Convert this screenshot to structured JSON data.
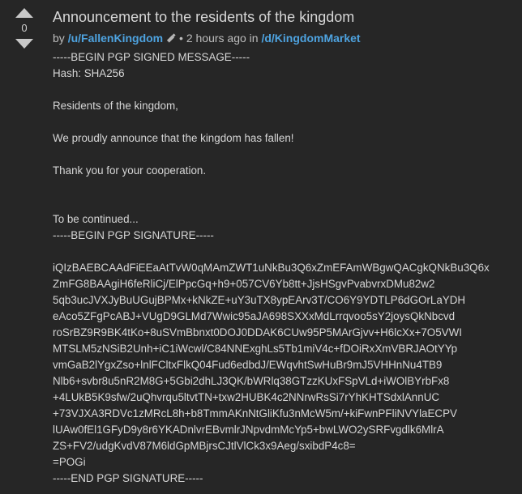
{
  "vote": {
    "score": "0",
    "upvote_icon": "upvote-arrow-icon",
    "downvote_icon": "downvote-arrow-icon"
  },
  "post": {
    "title": "Announcement to the residents of the kingdom",
    "meta": {
      "prefix": "by",
      "author": "/u/FallenKingdom",
      "badge_icon": "pgp-key-icon",
      "separator": "•",
      "time": "2 hours ago",
      "in_label": "in",
      "community": "/d/KingdomMarket"
    },
    "body_lines": [
      "-----BEGIN PGP SIGNED MESSAGE-----",
      "Hash: SHA256",
      "",
      "Residents of the kingdom,",
      "",
      "We proudly announce that the kingdom has fallen!",
      "",
      "Thank you for your cooperation.",
      "",
      "",
      "To be continued...",
      "-----BEGIN PGP SIGNATURE-----",
      "",
      "iQIzBAEBCAAdFiEEaAtTvW0qMAmZWT1uNkBu3Q6xZmEFAmWBgwQACgkQNkBu3Q6x",
      "ZmFG8BAAgiH6feRliCj/ElPpcGq+h9+057CV6Yb8tt+JjsHSgvPvabvrxDMu82w2",
      "5qb3ucJVXJyBuUGujBPMx+kNkZE+uY3uTX8ypEArv3T/CO6Y9YDTLP6dGOrLaYDH",
      "eAco5ZFgPcABJ+VUgD9GLMd7Wwic95aJA698SXXxMdLrrqvoo5sY2joysQkNbcvd",
      "roSrBZ9R9BK4tKo+8uSVmBbnxt0DOJ0DDAK6CUw95P5MArGjvv+H6lcXx+7O5VWI",
      "MTSLM5zNSiB2Unh+iC1iWcwl/C84NNExghLs5Tb1miV4c+fDOiRxXmVBRJAOtYYp",
      "vmGaB2lYgxZso+lnlFCltxFlkQ04Fud6edbdJ/EWqvhtSwHuBr9mJ5VHHnNu4TB9",
      "Nlb6+svbr8u5nR2M8G+5Gbi2dhLJ3QK/bWRlq38GTzzKUxFSpVLd+iWOlBYrbFx8",
      "+4LUkB5K9sfw/2uQhvrqu5ltvtTN+txw2HUBK4c2NNrwRsSi7rYhKHTSdxlAnnUC",
      "+73VJXA3RDVc1zMRcL8h+b8TmmAKnNtGliKfu3nMcW5m/+kiFwnPFliNVYlaECPV",
      "lUAw0fEl1GFyD9y8r6YKADnlvrEBvmlrJNpvdmMcYp5+bwLWO2ySRFvgdlk6MlrA",
      "ZS+FV2/udgKvdV87M6ldGpMBjrsCJtlVlCk3x9Aeg/sxibdP4c8=",
      "=POGi",
      "-----END PGP SIGNATURE-----"
    ]
  },
  "colors": {
    "background": "#262626",
    "link": "#4ea3e0",
    "text": "#d6d6d6",
    "vote_arrow": "#c8c8c8"
  }
}
